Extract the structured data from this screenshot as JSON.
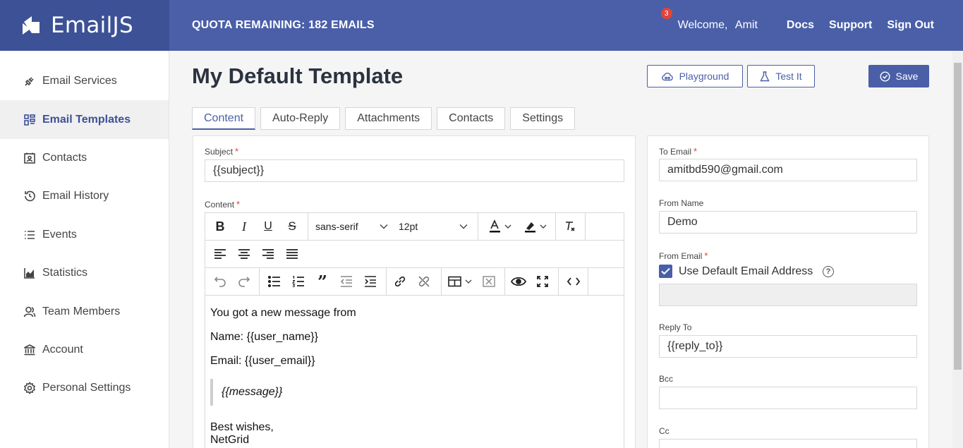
{
  "app": {
    "name": "EmailJS"
  },
  "header": {
    "quota": "QUOTA REMAINING: 182 EMAILS",
    "notification_count": "3",
    "welcome": "Welcome,",
    "user": "Amit",
    "links": [
      "Docs",
      "Support",
      "Sign Out"
    ]
  },
  "sidebar": {
    "items": [
      {
        "label": "Email Services",
        "icon": "plug-icon"
      },
      {
        "label": "Email Templates",
        "icon": "templates-icon",
        "active": true
      },
      {
        "label": "Contacts",
        "icon": "contact-card-icon"
      },
      {
        "label": "Email History",
        "icon": "history-icon"
      },
      {
        "label": "Events",
        "icon": "list-icon"
      },
      {
        "label": "Statistics",
        "icon": "chart-icon"
      },
      {
        "label": "Team Members",
        "icon": "user-group-icon"
      },
      {
        "label": "Account",
        "icon": "bank-icon"
      },
      {
        "label": "Personal Settings",
        "icon": "gear-icon"
      }
    ]
  },
  "page": {
    "title": "My Default Template",
    "buttons": {
      "playground": "Playground",
      "test": "Test It",
      "save": "Save"
    },
    "tabs": [
      "Content",
      "Auto-Reply",
      "Attachments",
      "Contacts",
      "Settings"
    ]
  },
  "content": {
    "subject_label": "Subject",
    "subject_value": "{{subject}}",
    "content_label": "Content",
    "toolbar": {
      "font": "sans-serif",
      "size": "12pt"
    },
    "body": {
      "line1": "You got a new message from",
      "line2": "Name: {{user_name}}",
      "line3": "Email: {{user_email}}",
      "quote": "{{message}}",
      "sign1": "Best wishes,",
      "sign2": "NetGrid"
    }
  },
  "settings": {
    "to_email_label": "To Email",
    "to_email_value": "amitbd590@gmail.com",
    "from_name_label": "From Name",
    "from_name_value": "Demo",
    "from_email_label": "From Email",
    "use_default_label": "Use Default Email Address",
    "reply_to_label": "Reply To",
    "reply_to_value": "{{reply_to}}",
    "bcc_label": "Bcc",
    "cc_label": "Cc"
  },
  "colors": {
    "brand": "#4a5fa8",
    "brand_dark": "#3c5196",
    "required": "#d9443b"
  }
}
